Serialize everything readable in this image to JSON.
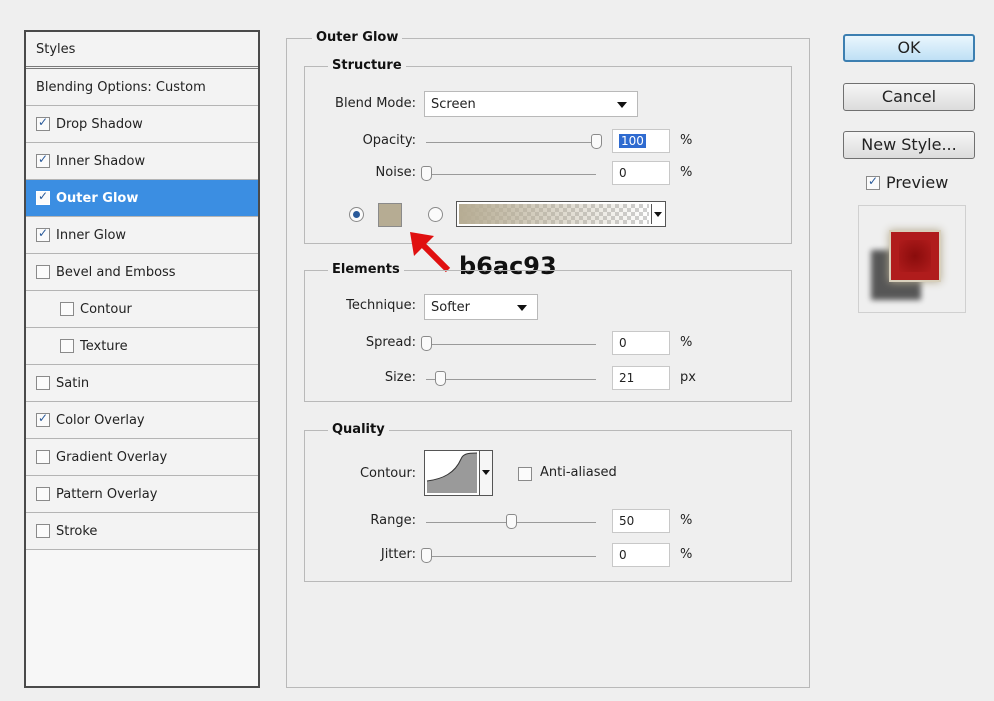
{
  "styles_panel": {
    "header": "Styles",
    "items": [
      {
        "label": "Blending Options: Custom",
        "checkbox": false,
        "checked": false,
        "selected": false,
        "indent": false
      },
      {
        "label": "Drop Shadow",
        "checkbox": true,
        "checked": true,
        "selected": false,
        "indent": false
      },
      {
        "label": "Inner Shadow",
        "checkbox": true,
        "checked": true,
        "selected": false,
        "indent": false
      },
      {
        "label": "Outer Glow",
        "checkbox": true,
        "checked": true,
        "selected": true,
        "indent": false
      },
      {
        "label": "Inner Glow",
        "checkbox": true,
        "checked": true,
        "selected": false,
        "indent": false
      },
      {
        "label": "Bevel and Emboss",
        "checkbox": true,
        "checked": false,
        "selected": false,
        "indent": false
      },
      {
        "label": "Contour",
        "checkbox": true,
        "checked": false,
        "selected": false,
        "indent": true
      },
      {
        "label": "Texture",
        "checkbox": true,
        "checked": false,
        "selected": false,
        "indent": true
      },
      {
        "label": "Satin",
        "checkbox": true,
        "checked": false,
        "selected": false,
        "indent": false
      },
      {
        "label": "Color Overlay",
        "checkbox": true,
        "checked": true,
        "selected": false,
        "indent": false
      },
      {
        "label": "Gradient Overlay",
        "checkbox": true,
        "checked": false,
        "selected": false,
        "indent": false
      },
      {
        "label": "Pattern Overlay",
        "checkbox": true,
        "checked": false,
        "selected": false,
        "indent": false
      },
      {
        "label": "Stroke",
        "checkbox": true,
        "checked": false,
        "selected": false,
        "indent": false
      }
    ]
  },
  "outer_glow": {
    "title": "Outer Glow",
    "structure": {
      "title": "Structure",
      "blend_mode_label": "Blend Mode:",
      "blend_mode_value": "Screen",
      "opacity_label": "Opacity:",
      "opacity_value": "100",
      "opacity_unit": "%",
      "opacity_level": 1.0,
      "noise_label": "Noise:",
      "noise_value": "0",
      "noise_unit": "%",
      "noise_level": 0.0,
      "glow_color": "#b6ac93",
      "solid_color_selected": true
    },
    "annotation": "b6ac93",
    "elements": {
      "title": "Elements",
      "technique_label": "Technique:",
      "technique_value": "Softer",
      "spread_label": "Spread:",
      "spread_value": "0",
      "spread_unit": "%",
      "spread_level": 0.0,
      "size_label": "Size:",
      "size_value": "21",
      "size_unit": "px",
      "size_level": 0.084
    },
    "quality": {
      "title": "Quality",
      "contour_label": "Contour:",
      "anti_aliased_label": "Anti-aliased",
      "anti_aliased_checked": false,
      "range_label": "Range:",
      "range_value": "50",
      "range_unit": "%",
      "range_level": 0.5,
      "jitter_label": "Jitter:",
      "jitter_value": "0",
      "jitter_unit": "%",
      "jitter_level": 0.0
    }
  },
  "buttons": {
    "ok": "OK",
    "cancel": "Cancel",
    "new_style": "New Style...",
    "preview_label": "Preview",
    "preview_checked": true
  },
  "colors": {
    "selection": "#3b8ee2",
    "annotation_arrow": "#e01010",
    "preview_red": "#b01c1c"
  }
}
